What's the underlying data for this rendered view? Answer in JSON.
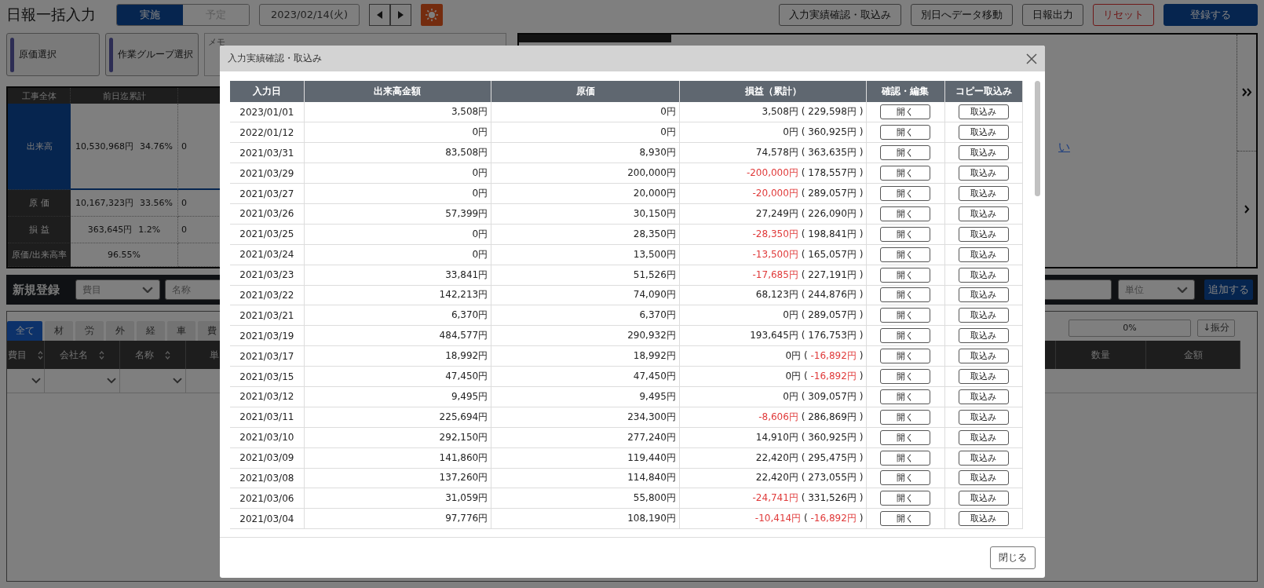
{
  "header": {
    "title": "日報一括入力",
    "mode_tabs": [
      {
        "label": "実施",
        "selected": true
      },
      {
        "label": "予定",
        "selected": false
      }
    ],
    "date": "2023/02/14(火)",
    "actions": [
      {
        "label": "入力実績確認・取込み",
        "kind": "default"
      },
      {
        "label": "別日へデータ移動",
        "kind": "default"
      },
      {
        "label": "日報出力",
        "kind": "default"
      },
      {
        "label": "リセット",
        "kind": "danger"
      },
      {
        "label": "登録する",
        "kind": "primary"
      }
    ]
  },
  "selectors": [
    {
      "label": "原価選択"
    },
    {
      "label": "作業グループ選択"
    }
  ],
  "memo": {
    "label": "メモ"
  },
  "summary": {
    "columns": [
      "工事全体",
      "前日迄累計"
    ],
    "rows": [
      {
        "label": "出来高",
        "amount": "10,530,968円",
        "rate": "34.76%",
        "column_3": "0",
        "selected": true
      },
      {
        "label": "原 価",
        "amount": "10,167,323円",
        "rate": "33.56%",
        "column_3": "0",
        "selected": false
      },
      {
        "label": "損 益",
        "amount": "363,645円",
        "rate": "1.2%",
        "column_3": "0",
        "selected": false
      },
      {
        "label": "原価/出来高率",
        "rate": "96.55%",
        "selected": false
      }
    ]
  },
  "right_panel": {
    "link": "い"
  },
  "new_entry": {
    "title": "新規登録",
    "fields": [
      {
        "placeholder": "費目",
        "kind": "select"
      },
      {
        "placeholder": "名称",
        "kind": "input"
      },
      {
        "placeholder": "単位",
        "kind": "select"
      }
    ],
    "add_button": "追加する"
  },
  "filter_tabs": [
    {
      "label": "全て",
      "selected": true
    },
    {
      "label": "材",
      "selected": false
    },
    {
      "label": "労",
      "selected": false
    },
    {
      "label": "外",
      "selected": false
    },
    {
      "label": "経",
      "selected": false
    },
    {
      "label": "車",
      "selected": false
    },
    {
      "label": "費",
      "selected": false
    }
  ],
  "allocation": {
    "progress": "0%",
    "level": 0,
    "button": "↓振分"
  },
  "grid": {
    "left_columns": [
      {
        "label": "費目",
        "sortable": true
      },
      {
        "label": "会社名",
        "sortable": true
      },
      {
        "label": "名称",
        "sortable": true
      },
      {
        "label": "単"
      }
    ],
    "right_columns": [
      {
        "label": "数量"
      },
      {
        "label": "金額"
      }
    ]
  },
  "modal": {
    "title": "入力実績確認・取込み",
    "columns": [
      "入力日",
      "出来高金額",
      "原価",
      "損益（累計）",
      "確認・編集",
      "コピー取込み"
    ],
    "rows": [
      {
        "date": "2023/01/01",
        "amount": "3,508円",
        "cost": "0円",
        "profit": "3,508円",
        "profit_negative": false,
        "cumulative": "229,598円",
        "cumulative_negative": false,
        "open": "開く",
        "import": "取込み"
      },
      {
        "date": "2022/01/12",
        "amount": "0円",
        "cost": "0円",
        "profit": "0円",
        "profit_negative": false,
        "cumulative": "360,925円",
        "cumulative_negative": false,
        "open": "開く",
        "import": "取込み"
      },
      {
        "date": "2021/03/31",
        "amount": "83,508円",
        "cost": "8,930円",
        "profit": "74,578円",
        "profit_negative": false,
        "cumulative": "363,635円",
        "cumulative_negative": false,
        "open": "開く",
        "import": "取込み"
      },
      {
        "date": "2021/03/29",
        "amount": "0円",
        "cost": "200,000円",
        "profit": "-200,000円",
        "profit_negative": true,
        "cumulative": "178,557円",
        "cumulative_negative": false,
        "open": "開く",
        "import": "取込み"
      },
      {
        "date": "2021/03/27",
        "amount": "0円",
        "cost": "20,000円",
        "profit": "-20,000円",
        "profit_negative": true,
        "cumulative": "289,057円",
        "cumulative_negative": false,
        "open": "開く",
        "import": "取込み"
      },
      {
        "date": "2021/03/26",
        "amount": "57,399円",
        "cost": "30,150円",
        "profit": "27,249円",
        "profit_negative": false,
        "cumulative": "226,090円",
        "cumulative_negative": false,
        "open": "開く",
        "import": "取込み"
      },
      {
        "date": "2021/03/25",
        "amount": "0円",
        "cost": "28,350円",
        "profit": "-28,350円",
        "profit_negative": true,
        "cumulative": "198,841円",
        "cumulative_negative": false,
        "open": "開く",
        "import": "取込み"
      },
      {
        "date": "2021/03/24",
        "amount": "0円",
        "cost": "13,500円",
        "profit": "-13,500円",
        "profit_negative": true,
        "cumulative": "165,057円",
        "cumulative_negative": false,
        "open": "開く",
        "import": "取込み"
      },
      {
        "date": "2021/03/23",
        "amount": "33,841円",
        "cost": "51,526円",
        "profit": "-17,685円",
        "profit_negative": true,
        "cumulative": "227,191円",
        "cumulative_negative": false,
        "open": "開く",
        "import": "取込み"
      },
      {
        "date": "2021/03/22",
        "amount": "142,213円",
        "cost": "74,090円",
        "profit": "68,123円",
        "profit_negative": false,
        "cumulative": "244,876円",
        "cumulative_negative": false,
        "open": "開く",
        "import": "取込み"
      },
      {
        "date": "2021/03/21",
        "amount": "6,370円",
        "cost": "6,370円",
        "profit": "0円",
        "profit_negative": false,
        "cumulative": "289,057円",
        "cumulative_negative": false,
        "open": "開く",
        "import": "取込み"
      },
      {
        "date": "2021/03/19",
        "amount": "484,577円",
        "cost": "290,932円",
        "profit": "193,645円",
        "profit_negative": false,
        "cumulative": "176,753円",
        "cumulative_negative": false,
        "open": "開く",
        "import": "取込み"
      },
      {
        "date": "2021/03/17",
        "amount": "18,992円",
        "cost": "18,992円",
        "profit": "0円",
        "profit_negative": false,
        "cumulative": "-16,892円",
        "cumulative_negative": true,
        "open": "開く",
        "import": "取込み"
      },
      {
        "date": "2021/03/15",
        "amount": "47,450円",
        "cost": "47,450円",
        "profit": "0円",
        "profit_negative": false,
        "cumulative": "-16,892円",
        "cumulative_negative": true,
        "open": "開く",
        "import": "取込み"
      },
      {
        "date": "2021/03/12",
        "amount": "9,495円",
        "cost": "9,495円",
        "profit": "0円",
        "profit_negative": false,
        "cumulative": "309,057円",
        "cumulative_negative": false,
        "open": "開く",
        "import": "取込み"
      },
      {
        "date": "2021/03/11",
        "amount": "225,694円",
        "cost": "234,300円",
        "profit": "-8,606円",
        "profit_negative": true,
        "cumulative": "286,869円",
        "cumulative_negative": false,
        "open": "開く",
        "import": "取込み"
      },
      {
        "date": "2021/03/10",
        "amount": "292,150円",
        "cost": "277,240円",
        "profit": "14,910円",
        "profit_negative": false,
        "cumulative": "360,925円",
        "cumulative_negative": false,
        "open": "開く",
        "import": "取込み"
      },
      {
        "date": "2021/03/09",
        "amount": "141,860円",
        "cost": "119,440円",
        "profit": "22,420円",
        "profit_negative": false,
        "cumulative": "295,475円",
        "cumulative_negative": false,
        "open": "開く",
        "import": "取込み"
      },
      {
        "date": "2021/03/08",
        "amount": "137,260円",
        "cost": "114,840円",
        "profit": "22,420円",
        "profit_negative": false,
        "cumulative": "273,055円",
        "cumulative_negative": false,
        "open": "開く",
        "import": "取込み"
      },
      {
        "date": "2021/03/06",
        "amount": "31,059円",
        "cost": "55,800円",
        "profit": "-24,741円",
        "profit_negative": true,
        "cumulative": "331,526円",
        "cumulative_negative": false,
        "open": "開く",
        "import": "取込み"
      },
      {
        "date": "2021/03/04",
        "amount": "97,776円",
        "cost": "108,190円",
        "profit": "-10,414円",
        "profit_negative": true,
        "cumulative": "-16,892円",
        "cumulative_negative": true,
        "open": "開く",
        "import": "取込み"
      }
    ],
    "paren_open": "(",
    "paren_close": ")",
    "close_button": "閉じる"
  }
}
